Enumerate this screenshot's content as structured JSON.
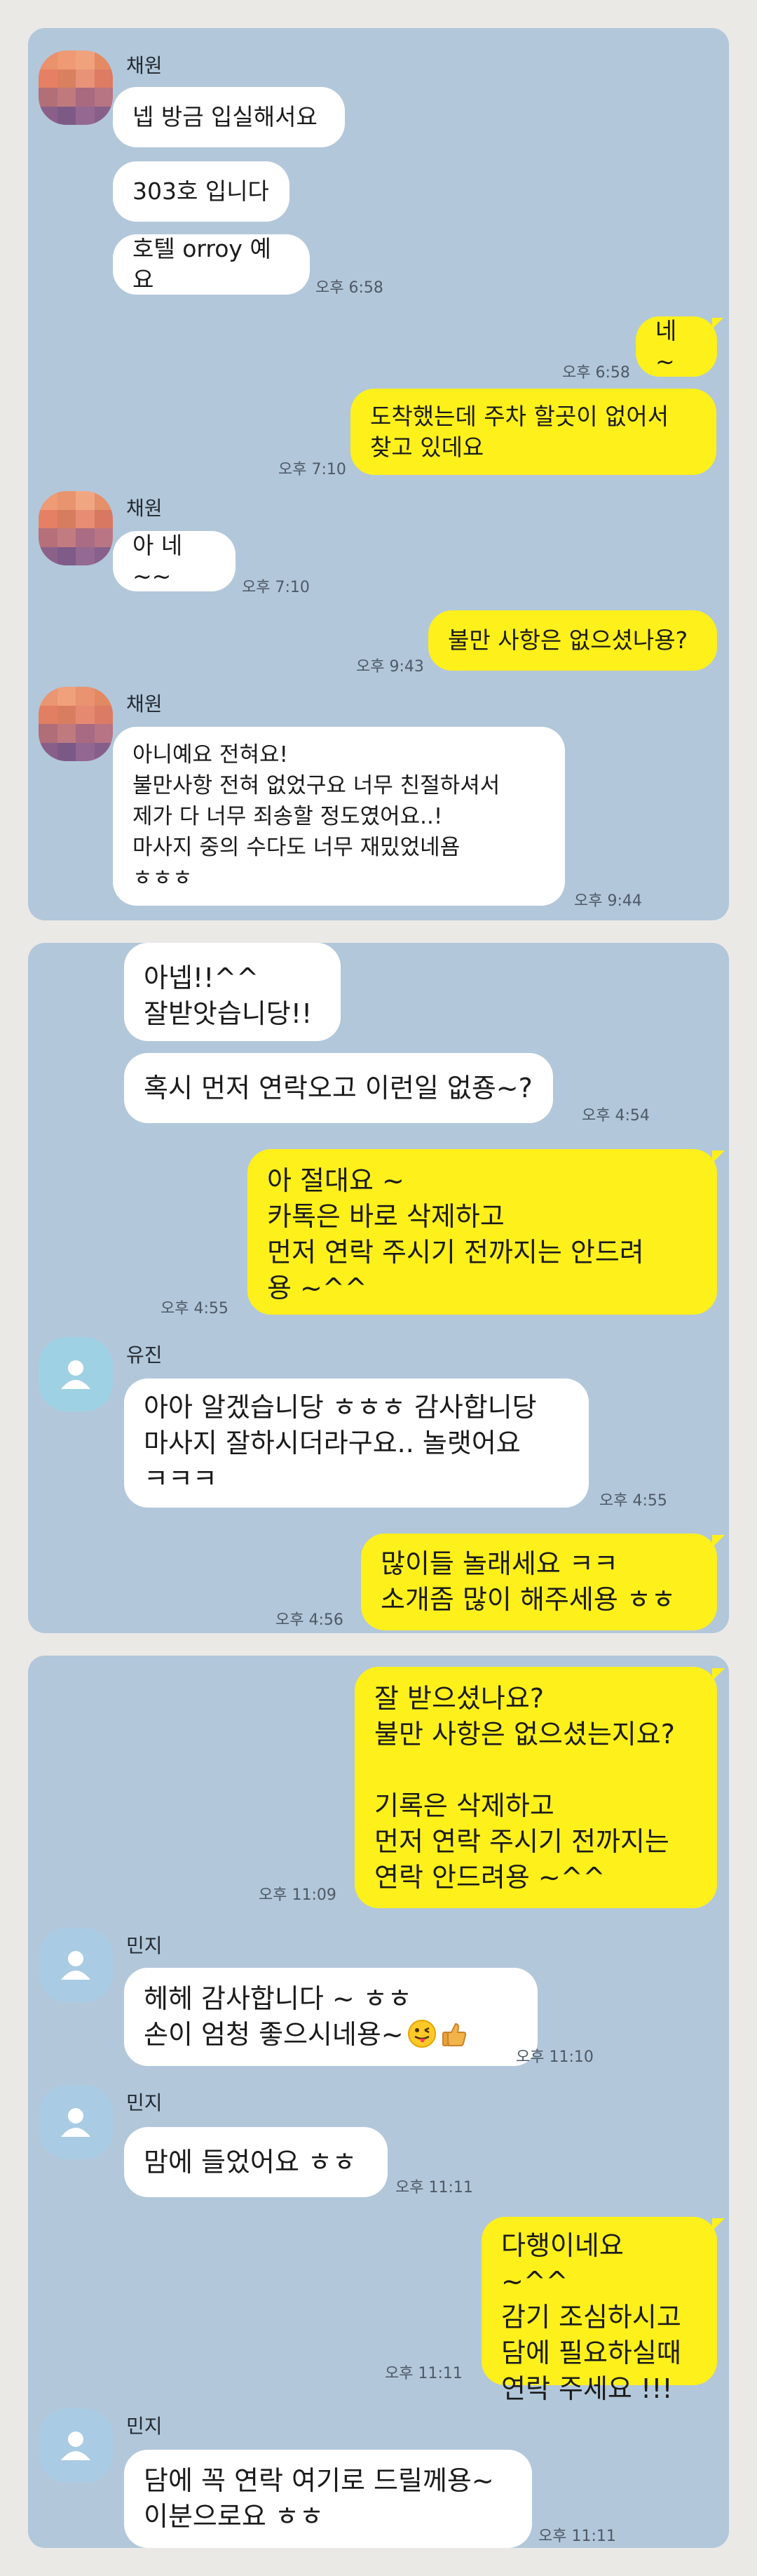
{
  "panel1": {
    "sender": "채원",
    "messages": [
      {
        "text": "넵 방금 입실해서요"
      },
      {
        "text": "303호 입니다"
      },
      {
        "text": "호텔 orroy 예요",
        "time": "오후 6:58"
      },
      {
        "text": "네 ~",
        "time": "오후 6:58"
      },
      {
        "text": "도착했는데  주차 할곳이 없어서\n찾고 있데요",
        "time": "오후 7:10"
      },
      {
        "text": "아 네~~",
        "time": "오후 7:10"
      },
      {
        "text": "불만 사항은 없으셨나용?",
        "time": "오후 9:43"
      },
      {
        "text": "아니예요 전혀요!\n불만사항 전혀 없었구요 너무 친절하셔서\n제가 다 너무 죄송할 정도였어요..!\n마사지 중의 수다도 너무 재밌었네욤\nㅎㅎㅎ",
        "time": "오후 9:44"
      }
    ]
  },
  "panel2": {
    "sender": "유진",
    "messages": [
      {
        "text": "아넵!!^^\n잘받앗습니당!!"
      },
      {
        "text": "혹시 먼저 연락오고 이런일 없죵~?",
        "time": "오후 4:54"
      },
      {
        "text": "아 절대요 ~\n카톡은 바로 삭제하고\n먼저 연락 주시기 전까지는 안드려\n용 ~^^",
        "time": "오후 4:55"
      },
      {
        "text": "아아 알겠습니당 ㅎㅎㅎ 감사합니당\n마사지 잘하시더라구요.. 놀랫어요\nㅋㅋㅋ",
        "time": "오후 4:55"
      },
      {
        "text": "많이들 놀래세요 ㅋㅋ\n소개좀 많이 해주세용 ㅎㅎ",
        "time": "오후 4:56"
      }
    ]
  },
  "panel3": {
    "sender": "민지",
    "messages": [
      {
        "text": "잘 받으셨나요?\n불만 사항은 없으셨는지요?\n\n기록은 삭제하고\n먼저 연락 주시기 전까지는\n연락 안드려용 ~^^",
        "time": "오후 11:09"
      },
      {
        "text": "헤헤 감사합니다 ~ ㅎㅎ\n손이 엄청 좋으시네용~",
        "time": "오후 11:10"
      },
      {
        "text": "맘에 들었어요 ㅎㅎ",
        "time": "오후 11:11"
      },
      {
        "text": "다행이네요 ~^^\n감기 조심하시고\n담에 필요하실때\n연락 주세요 !!!",
        "time": "오후 11:11"
      },
      {
        "text": "담에 꼭 연락 여기로 드릴께용~\n이분으로요 ㅎㅎ",
        "time": "오후 11:11"
      }
    ]
  },
  "colors": {
    "bg": "#b2c7da",
    "outgoing": "#fef01b",
    "incoming": "#ffffff"
  },
  "icons": [
    "person-icon",
    "tongue-out-emoji",
    "thumbs-up-emoji"
  ]
}
